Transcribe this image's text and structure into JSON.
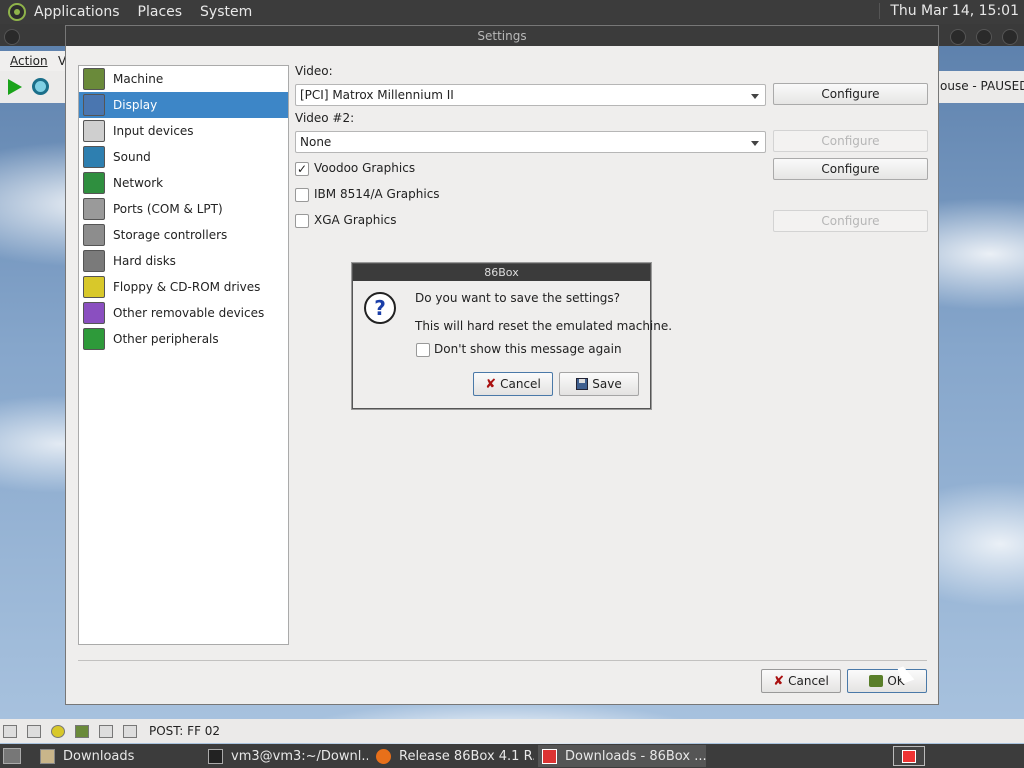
{
  "top_panel": {
    "menus": [
      "Applications",
      "Places",
      "System"
    ],
    "clock": "Thu Mar 14, 15:01"
  },
  "emulator": {
    "menu_action": "Action",
    "menu_v": "V",
    "status_suffix": "ouse - PAUSED",
    "post": "POST: FF 02"
  },
  "settings": {
    "title": "Settings",
    "nav": [
      {
        "label": "Machine",
        "icon": "machine-icon",
        "color": "#6a8a3a"
      },
      {
        "label": "Display",
        "icon": "display-icon",
        "color": "#4a76b0"
      },
      {
        "label": "Input devices",
        "icon": "input-devices-icon",
        "color": "#cfcfcf"
      },
      {
        "label": "Sound",
        "icon": "sound-icon",
        "color": "#2e7fb0"
      },
      {
        "label": "Network",
        "icon": "network-icon",
        "color": "#2f8f3f"
      },
      {
        "label": "Ports (COM & LPT)",
        "icon": "ports-icon",
        "color": "#9a9a9a"
      },
      {
        "label": "Storage controllers",
        "icon": "storage-controllers-icon",
        "color": "#8d8d8d"
      },
      {
        "label": "Hard disks",
        "icon": "hard-disks-icon",
        "color": "#7a7a7a"
      },
      {
        "label": "Floppy & CD-ROM drives",
        "icon": "floppy-cdrom-icon",
        "color": "#d8c82a"
      },
      {
        "label": "Other removable devices",
        "icon": "removable-devices-icon",
        "color": "#8a4fc0"
      },
      {
        "label": "Other peripherals",
        "icon": "peripherals-icon",
        "color": "#2e9a3a"
      }
    ],
    "selected_index": 1,
    "video_label": "Video:",
    "video_value": "[PCI] Matrox Millennium II",
    "video2_label": "Video #2:",
    "video2_value": "None",
    "configure": "Configure",
    "checkboxes": [
      {
        "label": "Voodoo Graphics",
        "checked": true
      },
      {
        "label": "IBM 8514/A Graphics",
        "checked": false
      },
      {
        "label": "XGA Graphics",
        "checked": false
      }
    ],
    "checkmark": "✓",
    "cancel": "Cancel",
    "ok": "OK"
  },
  "dialog": {
    "title": "86Box",
    "question": "Do you want to save the settings?",
    "detail": "This will hard reset the emulated machine.",
    "dont_show": "Don't show this message again",
    "cancel": "Cancel",
    "save": "Save",
    "icon_glyph": "?"
  },
  "taskbar": {
    "tasks": [
      {
        "label": "Downloads",
        "icon": "folder-icon",
        "active": false
      },
      {
        "label": "vm3@vm3:~/Downl...",
        "icon": "terminal-icon",
        "active": false
      },
      {
        "label": "Release 86Box 4.1 R...",
        "icon": "firefox-icon",
        "active": false
      },
      {
        "label": "Downloads - 86Box ...",
        "icon": "86box-icon",
        "active": true
      }
    ]
  }
}
